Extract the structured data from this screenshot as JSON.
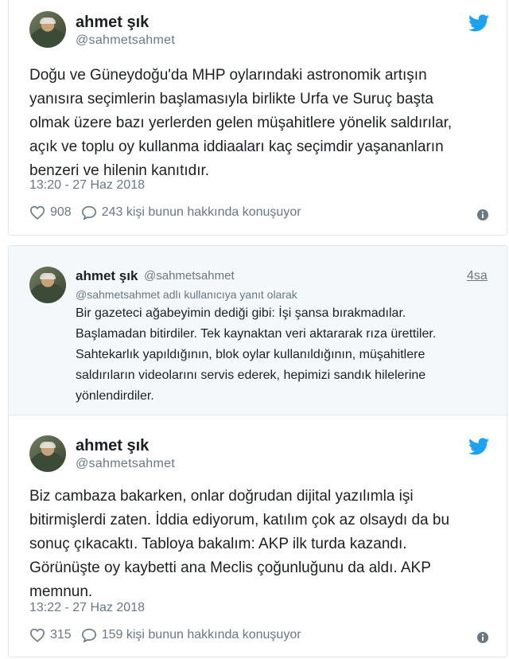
{
  "tweet1": {
    "name": "ahmet şık",
    "handle": "@sahmetsahmet",
    "lines": [
      "Doğu ve Güneydoğu'da MHP oylarındaki astronomik artışın",
      "yanısıra seçimlerin başlamasıyla birlikte Urfa ve Suruç başta",
      "olmak üzere bazı yerlerden gelen müşahitlere yönelik saldırılar,",
      "açık ve toplu oy kullanma iddiaaları kaç seçimdir yaşananların",
      "benzeri ve hilenin kanıtıdır."
    ],
    "timestamp": "13:20 - 27 Haz 2018",
    "likes": "908",
    "replies_text": "243 kişi bunun hakkında konuşuyor"
  },
  "reply": {
    "name": "ahmet şık",
    "handle": "@sahmetsahmet",
    "time": "4sa",
    "reply_to": "@sahmetsahmet adlı kullanıcıya yanıt olarak",
    "lines": [
      "Bir gazeteci ağabeyimin dediği gibi: İşi şansa bırakmadılar.",
      "Başlamadan bitirdiler. Tek kaynaktan veri aktararak rıza ürettiler.",
      "Sahtekarlık yapıldığının, blok oylar kullanıldığının, müşahitlere",
      "saldırıların videolarını servis ederek, hepimizi sandık hilelerine",
      "yönlendirdiler."
    ]
  },
  "tweet2": {
    "name": "ahmet şık",
    "handle": "@sahmetsahmet",
    "lines": [
      "Biz cambaza bakarken, onlar doğrudan dijital yazılımla işi",
      "bitirmişlerdi zaten. İddia ediyorum, katılım çok az olsaydı da bu",
      "sonuç çıkacaktı. Tabloya bakalım: AKP ilk turda kazandı.",
      "Görünüşte oy kaybetti ana Meclis çoğunluğunu da aldı. AKP",
      "memnun."
    ],
    "timestamp": "13:22 - 27 Haz 2018",
    "likes": "315",
    "replies_text": "159 kişi bunun hakkında konuşuyor"
  },
  "colors": {
    "twitter_blue": "#1da1f2",
    "meta_gray": "#697882",
    "border": "#e1e8ed",
    "reply_bg": "#f5f8fa"
  },
  "icons": [
    "twitter-bird-icon",
    "heart-icon",
    "comment-icon",
    "info-icon"
  ]
}
